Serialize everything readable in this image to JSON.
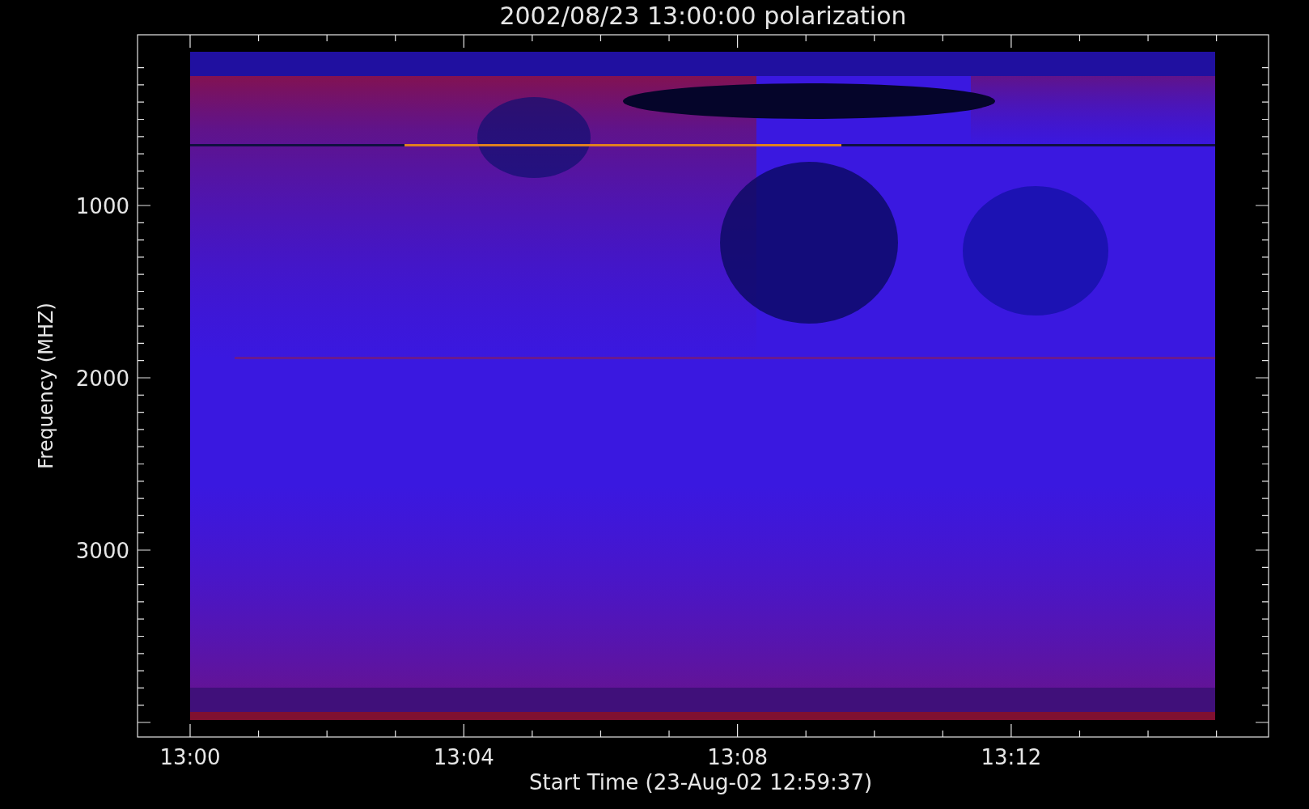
{
  "title": "2002/08/23 13:00:00 polarization",
  "y_axis": {
    "label": "Frequency (MHZ)",
    "tick_labels": [
      "1000",
      "2000",
      "3000"
    ]
  },
  "x_axis": {
    "label": "Start Time (23-Aug-02 12:59:37)",
    "tick_labels": [
      "13:00",
      "13:04",
      "13:08",
      "13:12"
    ]
  }
}
